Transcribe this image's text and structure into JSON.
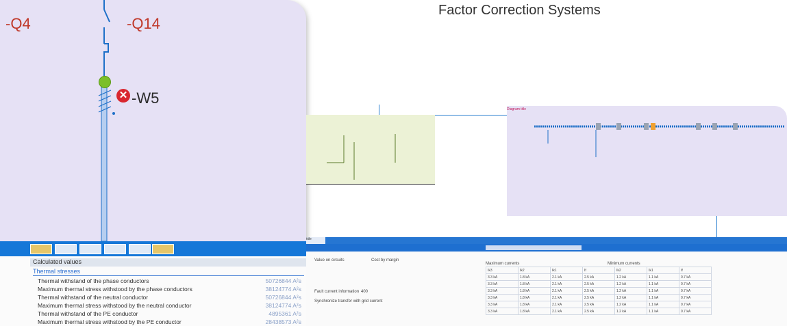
{
  "caption": "Factor Correction Systems",
  "left": {
    "label_q4": "-Q4",
    "label_q14": "-Q14",
    "label_w5": "-W5",
    "calc_title": "Calculated values",
    "section_title": "Thermal stresses",
    "rows": [
      {
        "label": "Thermal withstand of the phase conductors",
        "value": "50726844 A²s"
      },
      {
        "label": "Maximum thermal stress withstood by the phase conductors",
        "value": "38124774 A²s"
      },
      {
        "label": "Thermal withstand of the neutral conductor",
        "value": "50726844 A²s"
      },
      {
        "label": "Maximum thermal stress withstood by the neutral conductor",
        "value": "38124774 A²s"
      },
      {
        "label": "Thermal withstand of the PE conductor",
        "value": "4895361 A²s"
      },
      {
        "label": "Maximum thermal stress withstood by the PE conductor",
        "value": "28438573 A²s"
      }
    ]
  },
  "right_title": "Diagram title",
  "bottom": {
    "tab": "title",
    "radio1": "Value on circuits",
    "radio2": "Cost by margin",
    "field_label": "Fault current information",
    "field_value": "400",
    "checkbox_label": "Synchronize transfer with grid current",
    "table_header_left": "Maximum currents",
    "table_header_right": "Minimum currents",
    "columns": [
      "Ik3",
      "Ik2",
      "Ik1",
      "If",
      "Ik2",
      "Ik1",
      "If"
    ],
    "rows": [
      [
        "3.3 kA",
        "1.8 kA",
        "2.1 kA",
        "2.5 kA",
        "1.2 kA",
        "1.1 kA",
        "0.7 kA"
      ],
      [
        "3.3 kA",
        "1.8 kA",
        "2.1 kA",
        "2.5 kA",
        "1.2 kA",
        "1.1 kA",
        "0.7 kA"
      ],
      [
        "3.3 kA",
        "1.8 kA",
        "2.1 kA",
        "2.5 kA",
        "1.2 kA",
        "1.1 kA",
        "0.7 kA"
      ],
      [
        "3.3 kA",
        "1.8 kA",
        "2.1 kA",
        "2.5 kA",
        "1.2 kA",
        "1.1 kA",
        "0.7 kA"
      ],
      [
        "3.3 kA",
        "1.8 kA",
        "2.1 kA",
        "2.5 kA",
        "1.2 kA",
        "1.1 kA",
        "0.7 kA"
      ],
      [
        "3.3 kA",
        "1.8 kA",
        "2.1 kA",
        "2.5 kA",
        "1.2 kA",
        "1.1 kA",
        "0.7 kA"
      ]
    ]
  }
}
